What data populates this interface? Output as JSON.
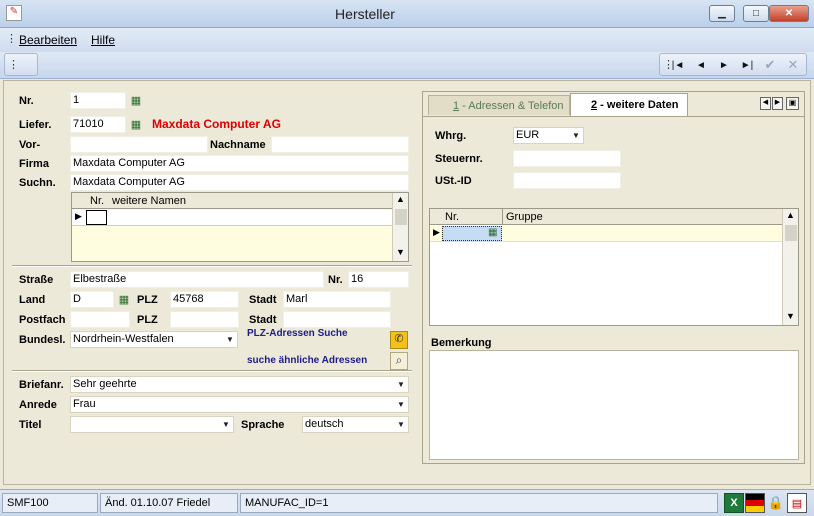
{
  "window": {
    "title": "Hersteller"
  },
  "menu": {
    "items": [
      {
        "label": "Bearbeiten"
      },
      {
        "label": "Hilfe"
      }
    ]
  },
  "toolbar": {
    "nav": [
      "|◄",
      "◄",
      "►",
      "►|",
      "✔",
      "✕"
    ]
  },
  "form": {
    "nr_label": "Nr.",
    "nr_value": "1",
    "liefer_label": "Liefer.",
    "liefer_value": "71010",
    "liefer_name": "Maxdata Computer  AG",
    "vor_label": "Vor-",
    "vor_value": "",
    "nachname_label": "Nachname",
    "nachname_value": "",
    "firma_label": "Firma",
    "firma_value": "Maxdata Computer  AG",
    "suchn_label": "Suchn.",
    "suchn_value": "Maxdata Computer  AG",
    "names_grid": {
      "col_nr": "Nr.",
      "col_names": "weitere Namen"
    },
    "strasse_label": "Straße",
    "strasse_value": "Elbestraße",
    "hausnr_label": "Nr.",
    "hausnr_value": "16",
    "land_label": "Land",
    "land_value": "D",
    "plz_label": "PLZ",
    "plz_value": "45768",
    "stadt_label": "Stadt",
    "stadt_value": "Marl",
    "postfach_label": "Postfach",
    "postfach_value": "",
    "plz2_label": "PLZ",
    "plz2_value": "",
    "stadt2_label": "Stadt",
    "stadt2_value": "",
    "bundesl_label": "Bundesl.",
    "bundesl_value": "Nordrhein-Westfalen",
    "plz_search_link": "PLZ-Adressen Suche",
    "similar_link": "suche ähnliche Adressen",
    "briefanr_label": "Briefanr.",
    "briefanr_value": "Sehr geehrte",
    "anrede_label": "Anrede",
    "anrede_value": "Frau",
    "titel_label": "Titel",
    "titel_value": "",
    "sprache_label": "Sprache",
    "sprache_value": "deutsch"
  },
  "tabs": [
    {
      "num": "1",
      "label": " - Adressen & Telefon"
    },
    {
      "num": "2",
      "label": " - weitere Daten"
    }
  ],
  "right": {
    "whrg_label": "Whrg.",
    "whrg_value": "EUR",
    "steuernr_label": "Steuernr.",
    "steuernr_value": "",
    "ustid_label": "USt.-ID",
    "ustid_value": "",
    "groups_grid": {
      "col_nr": "Nr.",
      "col_gruppe": "Gruppe"
    },
    "bemerkung_label": "Bemerkung",
    "bemerkung_value": ""
  },
  "status": {
    "code": "SMF100",
    "changed": "Änd. 01.10.07 Friedel",
    "record": "MANUFAC_ID=1"
  },
  "icons": [
    "excel-icon",
    "german-flag-icon",
    "lock-icon",
    "print-preview-icon"
  ]
}
